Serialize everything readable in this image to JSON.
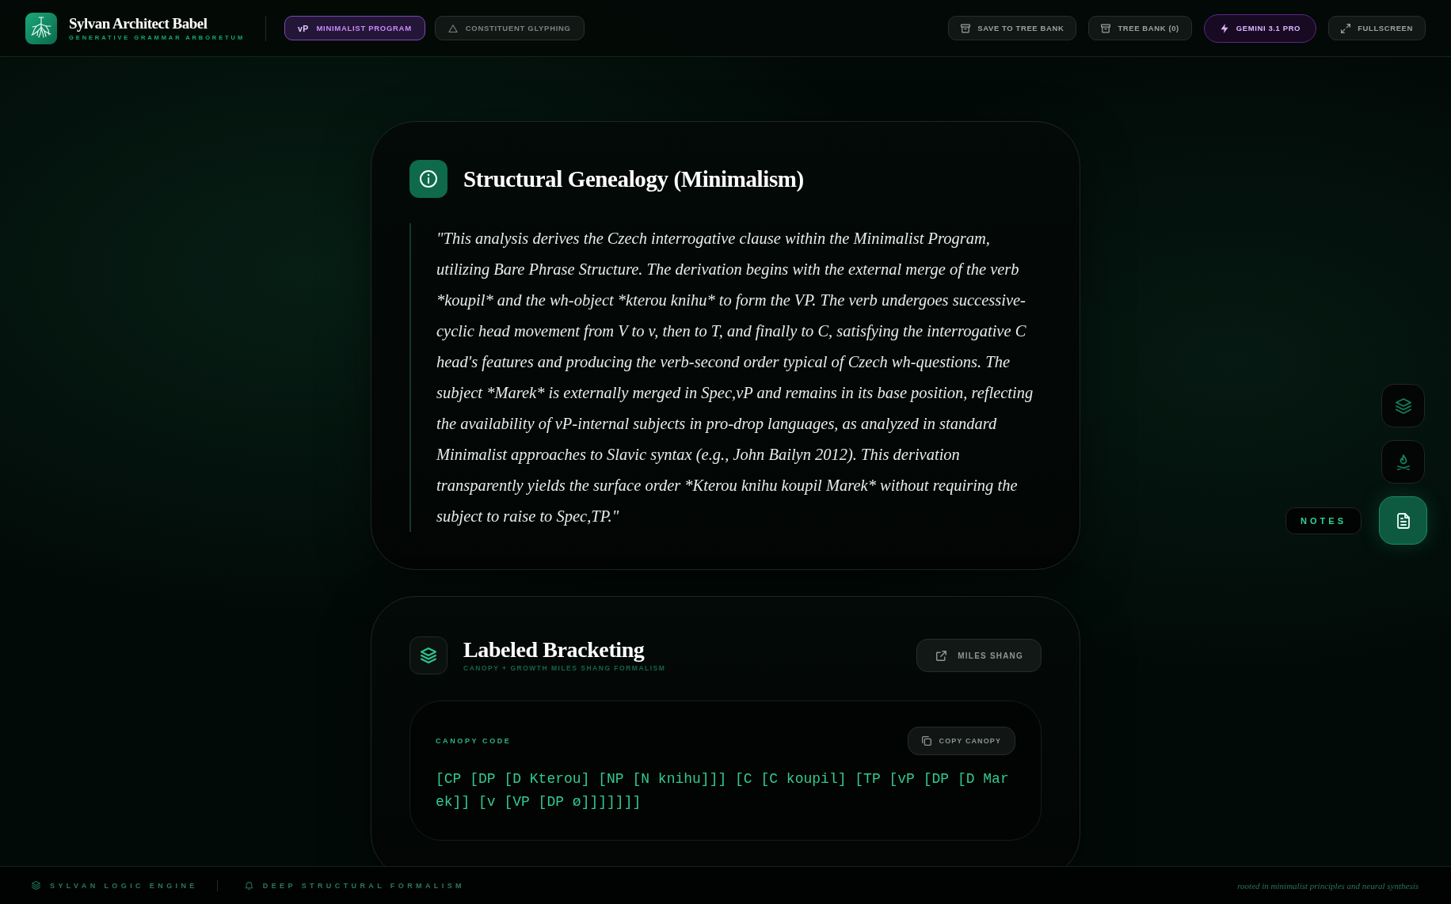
{
  "header": {
    "app_title": "Sylvan Architect Babel",
    "app_subtitle": "GENERATIVE GRAMMAR ARBORETUM",
    "modes": [
      {
        "badge": "vP",
        "label": "MINIMALIST PROGRAM",
        "selected": true
      },
      {
        "label": "CONSTITUENT GLYPHING",
        "selected": false
      }
    ],
    "actions": [
      {
        "kind": "save",
        "label": "SAVE TO TREE BANK"
      },
      {
        "kind": "bank",
        "label": "TREE BANK (0)"
      },
      {
        "kind": "model",
        "label": "GEMINI 3.1 PRO"
      },
      {
        "kind": "fullscreen",
        "label": "FULLSCREEN"
      }
    ]
  },
  "genealogy": {
    "title": "Structural Genealogy (Minimalism)",
    "text": "\"This analysis derives the Czech interrogative clause within the Minimalist Program, utilizing Bare Phrase Structure. The derivation begins with the external merge of the verb *koupil* and the wh-object *kterou knihu* to form the VP. The verb undergoes successive-cyclic head movement from V to v, then to T, and finally to C, satisfying the interrogative C head's features and producing the verb-second order typical of Czech wh-questions. The subject *Marek* is externally merged in Spec,vP and remains in its base position, reflecting the availability of vP-internal subjects in pro-drop languages, as analyzed in standard Minimalist approaches to Slavic syntax (e.g., John Bailyn 2012). This derivation transparently yields the surface order *Kterou knihu koupil Marek* without requiring the subject to raise to Spec,TP.\""
  },
  "bracketing": {
    "title": "Labeled Bracketing",
    "subtitle": "CANOPY + GROWTH MILES SHANG FORMALISM",
    "link_button": "MILES SHANG",
    "canopy": {
      "label": "CANOPY CODE",
      "copy_button": "COPY CANOPY",
      "code": "[CP [DP [D Kterou] [NP [N knihu]]] [C [C koupil] [TP [vP [DP [D Marek]] [v [VP [DP ø]]]]]]]"
    }
  },
  "side_rail": [
    {
      "selected": false
    },
    {
      "selected": false
    },
    {
      "selected": true,
      "tooltip": "NOTES"
    }
  ],
  "footer": {
    "items": [
      {
        "label": "SYLVAN LOGIC ENGINE"
      },
      {
        "label": "DEEP STRUCTURAL FORMALISM"
      }
    ],
    "tagline": "rooted in minimalist principles and neural synthesis"
  }
}
